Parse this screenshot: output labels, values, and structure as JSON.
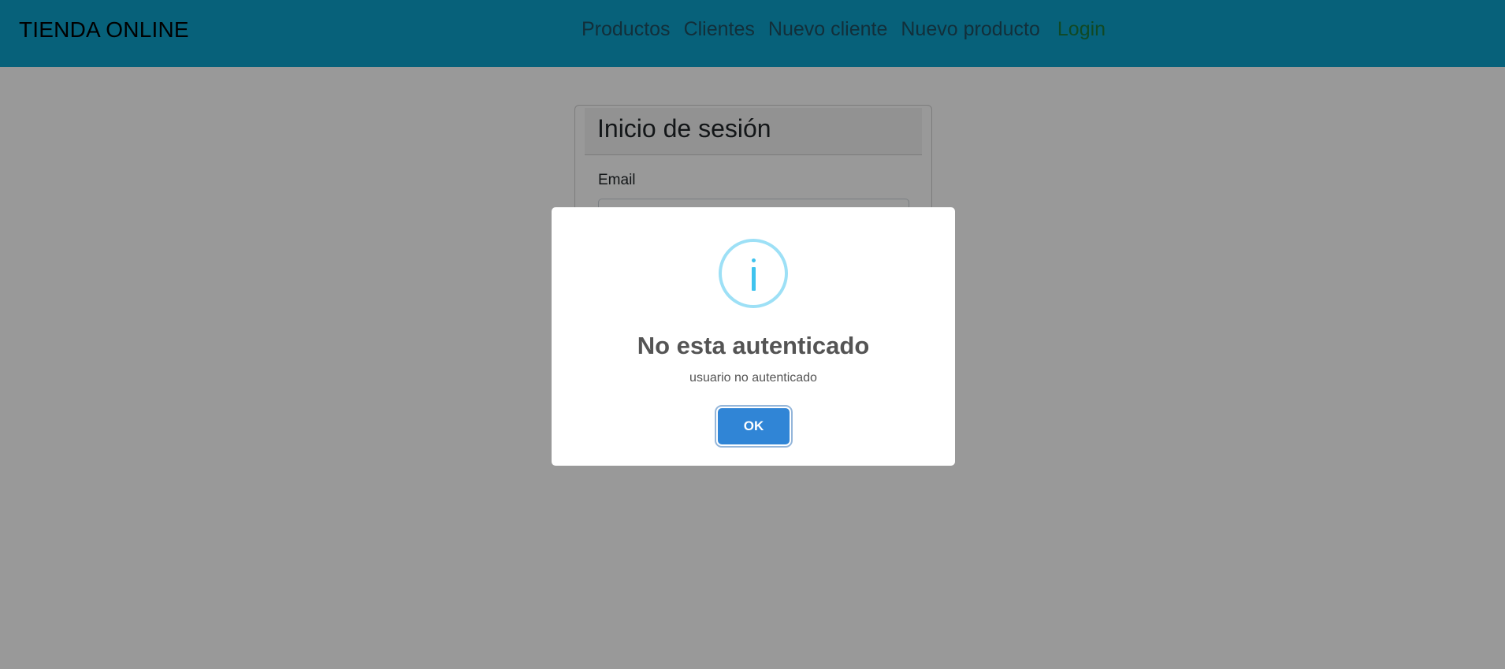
{
  "navbar": {
    "brand": "TIENDA ONLINE",
    "links": [
      "Productos",
      "Clientes",
      "Nuevo cliente",
      "Nuevo producto"
    ],
    "login": "Login"
  },
  "login_card": {
    "title": "Inicio de sesión",
    "email_label": "Email"
  },
  "alert": {
    "icon": "info-icon",
    "title": "No esta autenticado",
    "text": "usuario no autenticado",
    "ok_label": "OK"
  },
  "colors": {
    "navbar": "#0da2cb",
    "login_link": "#1b7a3d",
    "ok_button": "#3085d6",
    "info_icon": "#3fc3ee"
  }
}
